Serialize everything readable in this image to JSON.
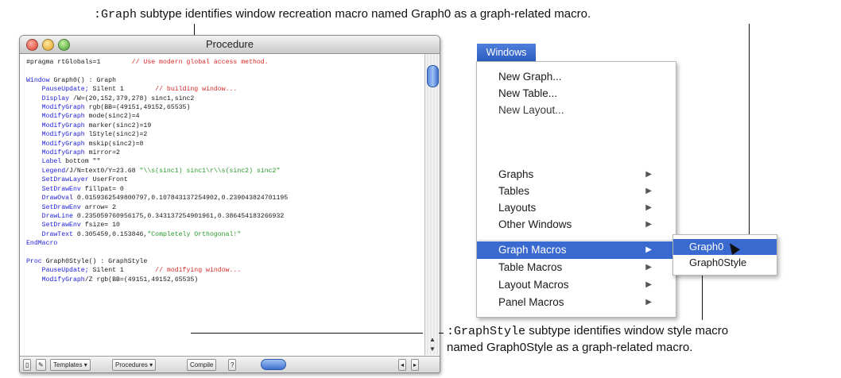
{
  "callout_top": {
    "prefix": ":Graph",
    "text": " subtype identifies window recreation macro named Graph0 as a graph-related macro."
  },
  "callout_bottom": {
    "prefix": ":GraphStyle",
    "text1": " subtype identifies window style macro",
    "text2": "named Graph0Style as a graph-related macro."
  },
  "window": {
    "title": "Procedure",
    "code": [
      {
        "t": "#pragma rtGlobals=1",
        "c": "        // Use modern global access method."
      },
      {
        "t": ""
      },
      {
        "k": "Window",
        "t": " Graph0() : Graph"
      },
      {
        "k": "    PauseUpdate;",
        "t": " Silent 1",
        "c": "        // building window..."
      },
      {
        "k": "    Display",
        "t": " /W=(20,152,379,278) sinc1,sinc2"
      },
      {
        "k": "    ModifyGraph",
        "t": " rgb(BB=(49151,49152,65535)"
      },
      {
        "k": "    ModifyGraph",
        "t": " mode(sinc2)=4"
      },
      {
        "k": "    ModifyGraph",
        "t": " marker(sinc2)=19"
      },
      {
        "k": "    ModifyGraph",
        "t": " lStyle(sinc2)=2"
      },
      {
        "k": "    ModifyGraph",
        "t": " mskip(sinc2)=8"
      },
      {
        "k": "    ModifyGraph",
        "t": " mirror=2"
      },
      {
        "k": "    Label",
        "t": " bottom \"\""
      },
      {
        "k": "    Legend",
        "t": "/J/N=text0/Y=23.68 ",
        "s": "\"\\\\s(sinc1) sinc1\\r\\\\s(sinc2) sinc2\""
      },
      {
        "k": "    SetDrawLayer",
        "t": " UserFront"
      },
      {
        "k": "    SetDrawEnv",
        "t": " fillpat= 0"
      },
      {
        "k": "    DrawOval",
        "t": " 0.0159362549800797,0.107843137254902,0.239043824701195"
      },
      {
        "k": "    SetDrawEnv",
        "t": " arrow= 2"
      },
      {
        "k": "    DrawLine",
        "t": " 0.235059760956175,0.343137254901961,0.386454183266932"
      },
      {
        "k": "    SetDrawEnv",
        "t": " fsize= 10"
      },
      {
        "k": "    DrawText",
        "t": " 0.305459,0.153846,",
        "s": "\"Completely Orthogonal!\""
      },
      {
        "k": "EndMacro",
        "t": ""
      },
      {
        "t": ""
      },
      {
        "k": "Proc",
        "t": " Graph0Style() : GraphStyle"
      },
      {
        "k": "    PauseUpdate;",
        "t": " Silent 1",
        "c": "        // modifying window..."
      },
      {
        "k": "    ModifyGraph",
        "t": "/Z rgb(BB=(49151,49152,65535)"
      }
    ],
    "bottom_bar": {
      "templates": "Templates",
      "procedures": "Procedures",
      "compile": "Compile"
    }
  },
  "menu": {
    "title": "Windows",
    "items": [
      "New Graph...",
      "New Table...",
      "New Layout...",
      "Graphs",
      "Tables",
      "Layouts",
      "Other Windows",
      "Graph Macros",
      "Table Macros",
      "Layout Macros",
      "Panel Macros"
    ],
    "submenu": [
      "Graph0",
      "Graph0Style"
    ]
  },
  "colors": {
    "selection": "#3a69d0",
    "keyword": "#2121d8",
    "comment": "#d42a2a",
    "string": "#2a9a2a"
  }
}
